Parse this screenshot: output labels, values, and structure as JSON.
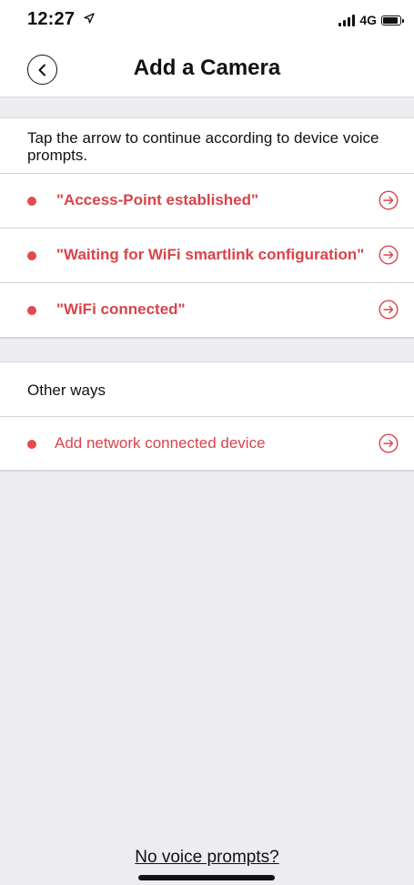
{
  "status_bar": {
    "time": "12:27",
    "network": "4G",
    "location_icon": "location-arrow",
    "signal_icon": "cellular-signal-bars",
    "battery_icon": "battery"
  },
  "header": {
    "title": "Add a Camera",
    "back_icon": "chevron-left-circle"
  },
  "instruction": "Tap the arrow to continue according to device voice prompts.",
  "voice_prompts": [
    {
      "label": "\"Access-Point established\""
    },
    {
      "label": "\"Waiting for WiFi smartlink configuration\""
    },
    {
      "label": "\"WiFi connected\""
    }
  ],
  "other_ways": {
    "heading": "Other ways",
    "items": [
      {
        "label": "Add network connected device"
      }
    ]
  },
  "footer": {
    "link": "No voice prompts?"
  },
  "colors": {
    "accent": "#d9434a",
    "background": "#ffffff",
    "band": "#ececf1",
    "text": "#111111"
  }
}
